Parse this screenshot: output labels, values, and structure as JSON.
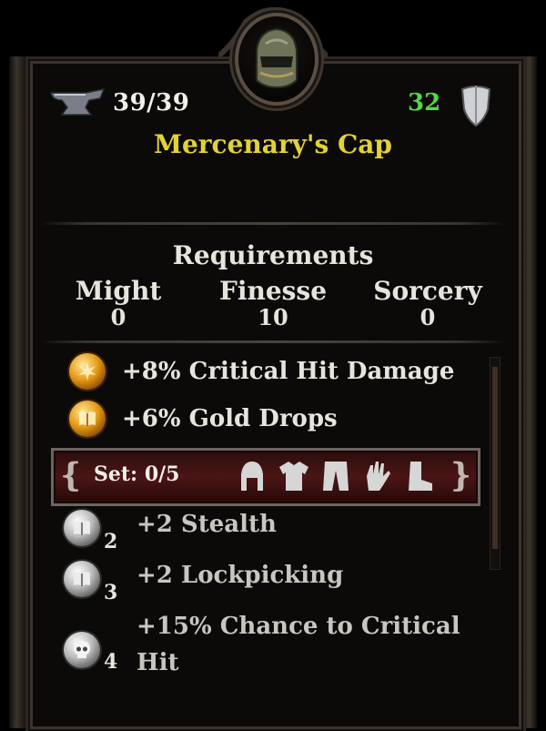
{
  "tooltip": {
    "durability": "39/39",
    "armor": "32",
    "item_name": "Mercenary's Cap",
    "colors": {
      "name": "#e3d234",
      "armor": "#54d845"
    }
  },
  "requirements": {
    "title": "Requirements",
    "columns": [
      {
        "label": "Might",
        "value": "0"
      },
      {
        "label": "Finesse",
        "value": "10"
      },
      {
        "label": "Sorcery",
        "value": "0"
      }
    ]
  },
  "stats": [
    {
      "text": "+8% Critical Hit Damage",
      "icon": "burst-orb-icon"
    },
    {
      "text": "+6% Gold Drops",
      "icon": "book-orb-icon"
    }
  ],
  "set": {
    "label": "Set: 0/5",
    "pieces": [
      "helm-icon",
      "chest-icon",
      "pants-icon",
      "glove-icon",
      "boot-icon"
    ]
  },
  "set_bonuses": [
    {
      "count": "2",
      "text": "+2 Stealth",
      "icon": "book-orb-icon"
    },
    {
      "count": "3",
      "text": "+2 Lockpicking",
      "icon": "book-orb-icon"
    },
    {
      "count": "4",
      "text_line1": "+15% Chance to Critical",
      "text_line2": "Hit",
      "icon": "skull-orb-icon"
    }
  ]
}
